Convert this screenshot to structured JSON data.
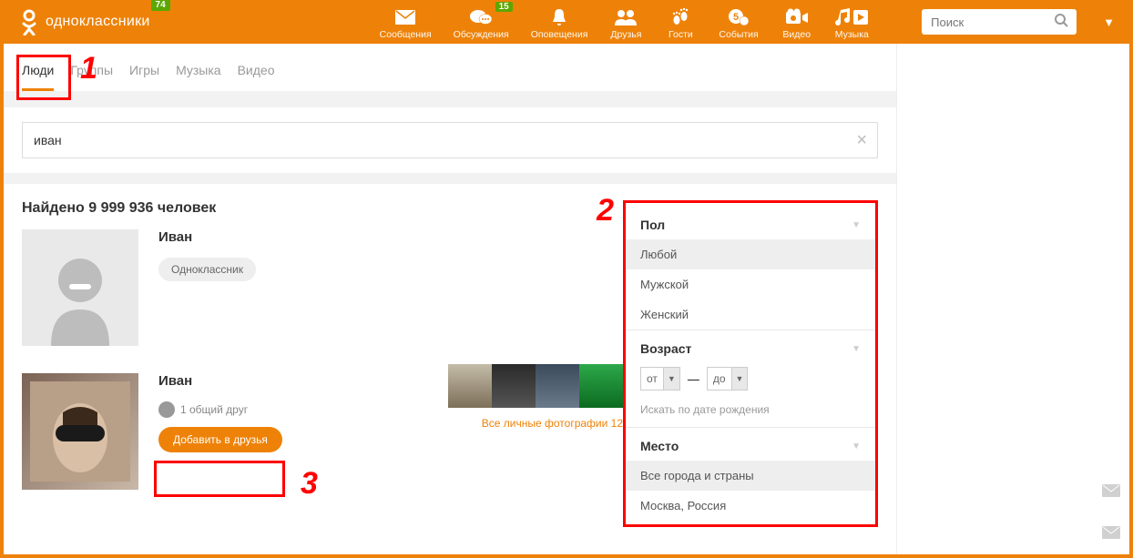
{
  "header": {
    "logo_text": "одноклассники",
    "logo_badge": "74",
    "nav": [
      {
        "label": "Сообщения",
        "icon": "mail",
        "badge": null
      },
      {
        "label": "Обсуждения",
        "icon": "chat",
        "badge": "15"
      },
      {
        "label": "Оповещения",
        "icon": "bell",
        "badge": null
      },
      {
        "label": "Друзья",
        "icon": "friends",
        "badge": null
      },
      {
        "label": "Гости",
        "icon": "feet",
        "badge": null
      },
      {
        "label": "События",
        "icon": "events",
        "badge": null
      },
      {
        "label": "Видео",
        "icon": "video",
        "badge": null
      },
      {
        "label": "Музыка",
        "icon": "music",
        "badge": null
      }
    ],
    "search_placeholder": "Поиск"
  },
  "tabs": {
    "items": [
      "Люди",
      "Группы",
      "Игры",
      "Музыка",
      "Видео"
    ],
    "active": 0
  },
  "search_value": "иван",
  "results": {
    "count_text": "Найдено 9 999 936 человек",
    "people": [
      {
        "name": "Иван",
        "tag": "Одноклассник"
      },
      {
        "name": "Иван",
        "mutual": "1 общий друг",
        "add_label": "Добавить в друзья"
      }
    ],
    "all_photos": "Все личные фотографии 12"
  },
  "filters": {
    "gender": {
      "title": "Пол",
      "options": [
        "Любой",
        "Мужской",
        "Женский"
      ],
      "selected": 0
    },
    "age": {
      "title": "Возраст",
      "from_label": "от",
      "to_label": "до",
      "dob_link": "Искать по дате рождения"
    },
    "place": {
      "title": "Место",
      "options": [
        "Все города и страны",
        "Москва, Россия"
      ],
      "selected": 0
    }
  },
  "annotations": {
    "n1": "1",
    "n2": "2",
    "n3": "3"
  }
}
